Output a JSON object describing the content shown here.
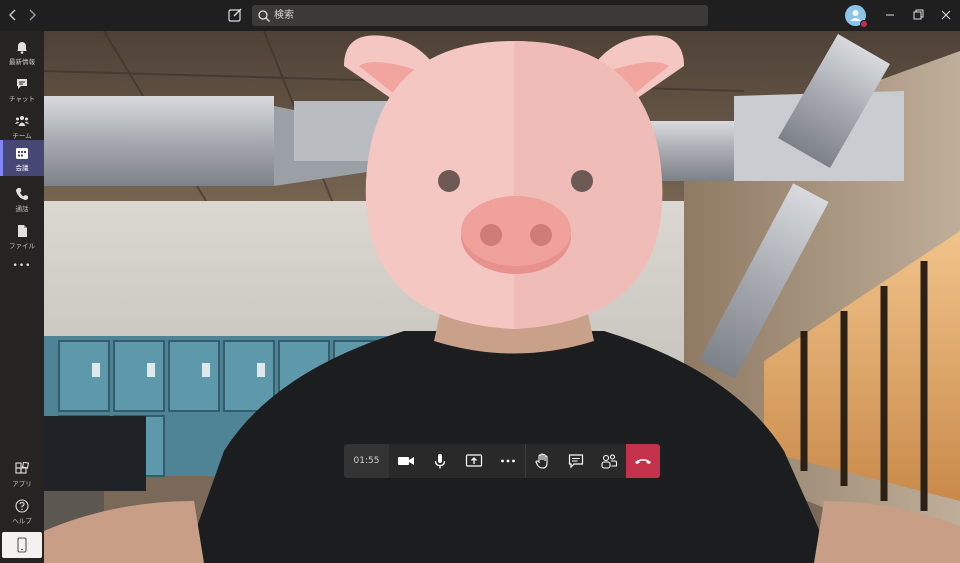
{
  "titlebar": {
    "search_placeholder": "検索"
  },
  "rail": {
    "items": [
      {
        "label": "最新情報",
        "icon": "bell-icon"
      },
      {
        "label": "チャット",
        "icon": "chat-icon"
      },
      {
        "label": "チーム",
        "icon": "teams-icon"
      },
      {
        "label": "会議",
        "icon": "calendar-icon"
      },
      {
        "label": "通話",
        "icon": "phone-icon"
      },
      {
        "label": "ファイル",
        "icon": "file-icon"
      },
      {
        "label": "アプリ",
        "icon": "apps-icon"
      },
      {
        "label": "ヘルプ",
        "icon": "help-icon"
      }
    ],
    "active": "会議",
    "more_glyph": "•••"
  },
  "call": {
    "timer": "01:55"
  },
  "colors": {
    "accent": "#464775",
    "accent_bar": "#7f85f5",
    "hangup": "#c4314b"
  }
}
